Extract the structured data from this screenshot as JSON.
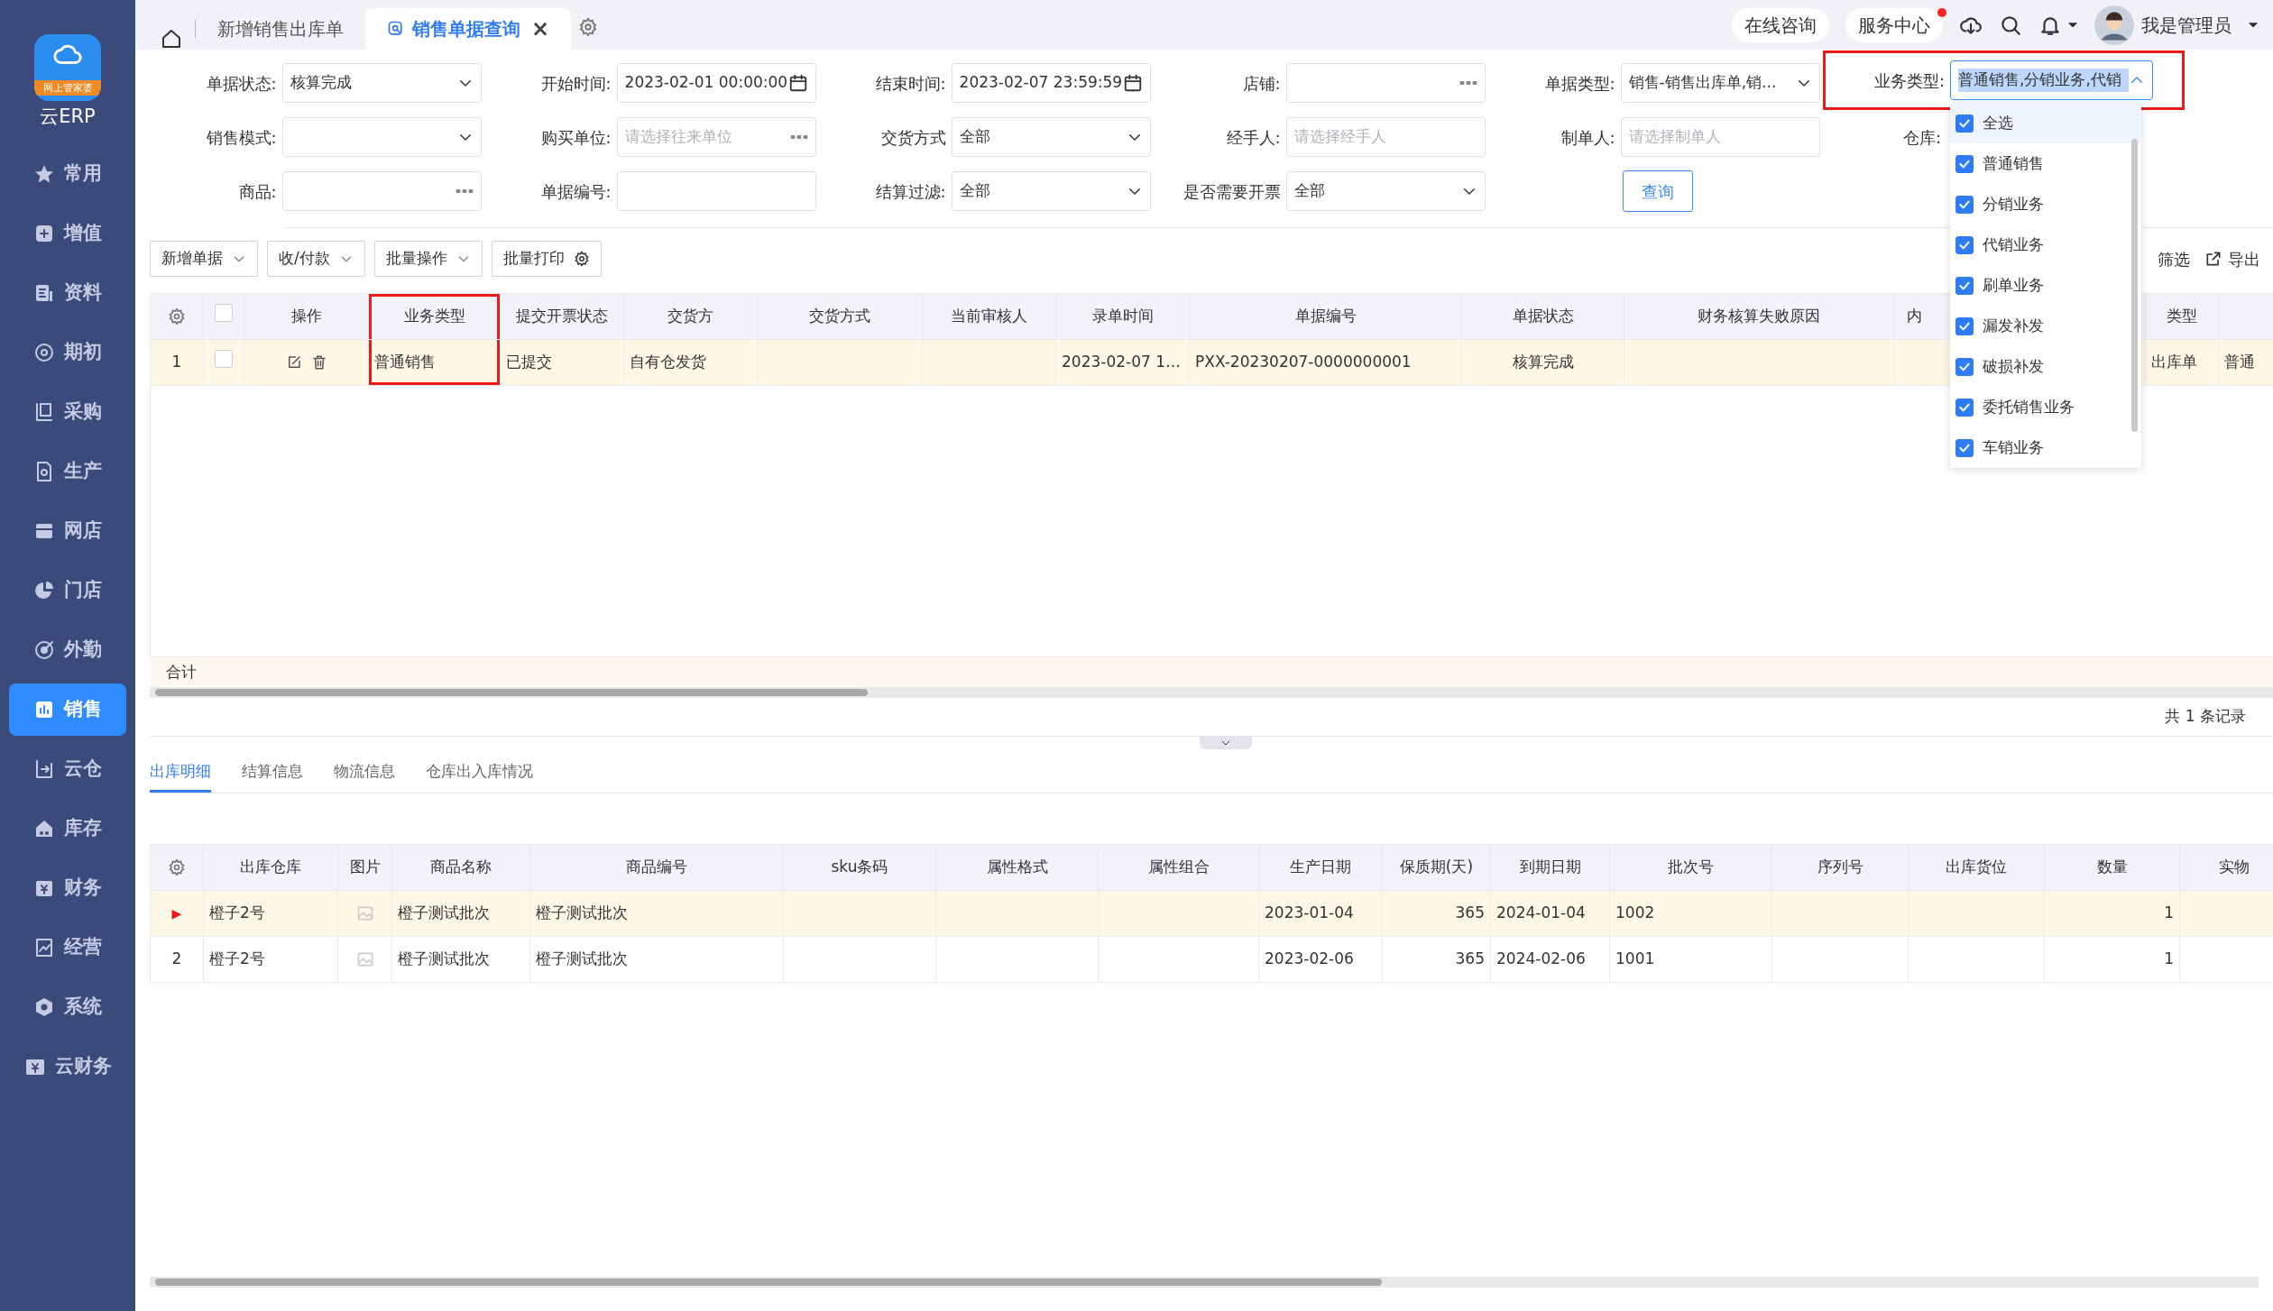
{
  "sidebar": {
    "logo_banner": "网上管家婆",
    "product": "云ERP",
    "items": [
      {
        "label": "常用",
        "selected": false
      },
      {
        "label": "增值",
        "selected": false
      },
      {
        "label": "资料",
        "selected": false
      },
      {
        "label": "期初",
        "selected": false
      },
      {
        "label": "采购",
        "selected": false
      },
      {
        "label": "生产",
        "selected": false
      },
      {
        "label": "网店",
        "selected": false
      },
      {
        "label": "门店",
        "selected": false
      },
      {
        "label": "外勤",
        "selected": false
      },
      {
        "label": "销售",
        "selected": true
      },
      {
        "label": "云仓",
        "selected": false
      },
      {
        "label": "库存",
        "selected": false
      },
      {
        "label": "财务",
        "selected": false
      },
      {
        "label": "经营",
        "selected": false
      },
      {
        "label": "系统",
        "selected": false
      },
      {
        "label": "云财务",
        "selected": false
      }
    ]
  },
  "tabs": [
    {
      "label": "新增销售出库单",
      "selected": false
    },
    {
      "label": "销售单据查询",
      "selected": true,
      "close": "×"
    }
  ],
  "header_links": [
    {
      "label": "在线咨询",
      "notify": false
    },
    {
      "label": "服务中心",
      "notify": true
    }
  ],
  "user": "我是管理员",
  "filters": [
    {
      "label": "单据状态:",
      "kind": "select",
      "value": "核算完成"
    },
    {
      "label": "开始时间:",
      "kind": "date",
      "value": "2023-02-01 00:00:00"
    },
    {
      "label": "结束时间:",
      "kind": "date",
      "value": "2023-02-07 23:59:59"
    },
    {
      "label": "店铺:",
      "kind": "picker"
    },
    {
      "label": "单据类型:",
      "kind": "select",
      "value": "销售-销售出库单,销..."
    },
    {
      "label": "业务类型:",
      "kind": "multiselect",
      "value": "普通销售,分销业务,代销",
      "highlighted": true,
      "open": true,
      "options": [
        {
          "label": "全选",
          "checked": true,
          "selected": true
        },
        {
          "label": "普通销售",
          "checked": true,
          "selected": false
        },
        {
          "label": "分销业务",
          "checked": true,
          "selected": false
        },
        {
          "label": "代销业务",
          "checked": true,
          "selected": false
        },
        {
          "label": "刷单业务",
          "checked": true,
          "selected": false
        },
        {
          "label": "漏发补发",
          "checked": true,
          "selected": false
        },
        {
          "label": "破损补发",
          "checked": true,
          "selected": false
        },
        {
          "label": "委托销售业务",
          "checked": true,
          "selected": false
        },
        {
          "label": "车销业务",
          "checked": true,
          "selected": false
        }
      ]
    },
    {
      "label": "销售模式:",
      "kind": "select"
    },
    {
      "label": "购买单位:",
      "kind": "picker",
      "placeholder": "请选择往来单位"
    },
    {
      "label": "交货方式",
      "kind": "select",
      "value": "全部"
    },
    {
      "label": "经手人:",
      "kind": "text",
      "placeholder": "请选择经手人"
    },
    {
      "label": "制单人:",
      "kind": "text",
      "placeholder": "请选择制单人"
    },
    {
      "label": "仓库:",
      "kind": "covered"
    },
    {
      "label": "商品:",
      "kind": "picker"
    },
    {
      "label": "单据编号:",
      "kind": "text"
    },
    {
      "label": "结算过滤:",
      "kind": "select",
      "value": "全部"
    },
    {
      "label": "是否需要开票",
      "kind": "select",
      "value": "全部"
    },
    {
      "label": "查询",
      "kind": "button"
    }
  ],
  "toolbar": {
    "buttons": [
      {
        "label": "新增单据",
        "kind": "dropdown"
      },
      {
        "label": "收/付款",
        "kind": "dropdown"
      },
      {
        "label": "批量操作",
        "kind": "dropdown"
      },
      {
        "label": "批量打印",
        "kind": "settings"
      }
    ],
    "right": [
      {
        "label": "筛选",
        "kind": "plain"
      },
      {
        "label": "导出",
        "kind": "export"
      }
    ]
  },
  "orders_table": {
    "columns": [
      {
        "kind": "settings"
      },
      {
        "kind": "check",
        "checked": false
      },
      {
        "kind": "actions",
        "label": "操作"
      },
      {
        "kind": "text",
        "label": "业务类型",
        "highlighted": true
      },
      {
        "kind": "text",
        "label": "提交开票状态"
      },
      {
        "kind": "text",
        "label": "交货方"
      },
      {
        "kind": "text",
        "label": "交货方式"
      },
      {
        "kind": "text",
        "label": "当前审核人"
      },
      {
        "kind": "text",
        "label": "录单时间"
      },
      {
        "kind": "text",
        "label": "单据编号"
      },
      {
        "kind": "status",
        "label": "单据状态"
      },
      {
        "kind": "text",
        "label": "财务核算失败原因"
      },
      {
        "kind": "text",
        "label": "内"
      },
      {
        "kind": "text",
        "label": "类型"
      },
      {
        "kind": "blank"
      }
    ],
    "rows": [
      {
        "checked": false,
        "selected": true,
        "cells": [
          "1",
          null,
          null,
          "普通销售",
          "已提交",
          "自有仓发货",
          null,
          null,
          "2023-02-07 1…",
          "PXX-20230207-0000000001",
          "核算完成",
          null,
          null,
          "出库单",
          "普通"
        ]
      }
    ],
    "summary_label": "合计",
    "record_count": "共 1 条记录"
  },
  "detail_tabs": [
    {
      "label": "出库明细",
      "selected": true
    },
    {
      "label": "结算信息",
      "selected": false
    },
    {
      "label": "物流信息",
      "selected": false
    },
    {
      "label": "仓库出入库情况",
      "selected": false
    }
  ],
  "detail_table": {
    "columns": [
      {
        "kind": "settings"
      },
      {
        "kind": "text",
        "label": "出库仓库"
      },
      {
        "kind": "image",
        "label": "图片"
      },
      {
        "kind": "text",
        "label": "商品名称"
      },
      {
        "kind": "text",
        "label": "商品编号"
      },
      {
        "kind": "center",
        "label": "sku条码"
      },
      {
        "kind": "center",
        "label": "属性格式"
      },
      {
        "kind": "center",
        "label": "属性组合"
      },
      {
        "kind": "text",
        "label": "生产日期"
      },
      {
        "kind": "number",
        "label": "保质期(天)"
      },
      {
        "kind": "text",
        "label": "到期日期"
      },
      {
        "kind": "text",
        "label": "批次号"
      },
      {
        "kind": "center",
        "label": "序列号"
      },
      {
        "kind": "center",
        "label": "出库货位"
      },
      {
        "kind": "number",
        "label": "数量"
      },
      {
        "kind": "center",
        "label": "实物"
      }
    ],
    "rows": [
      {
        "current": true,
        "cells": [
          "▶",
          "橙子2号",
          null,
          "橙子测试批次",
          "橙子测试批次",
          null,
          null,
          null,
          "2023-01-04",
          "365",
          "2024-01-04",
          "1002",
          null,
          null,
          "1",
          null
        ]
      },
      {
        "current": false,
        "cells": [
          "2",
          "橙子2号",
          null,
          "橙子测试批次",
          "橙子测试批次",
          null,
          null,
          null,
          "2023-02-06",
          "365",
          "2024-02-06",
          "1001",
          null,
          null,
          "1",
          null
        ]
      }
    ]
  }
}
